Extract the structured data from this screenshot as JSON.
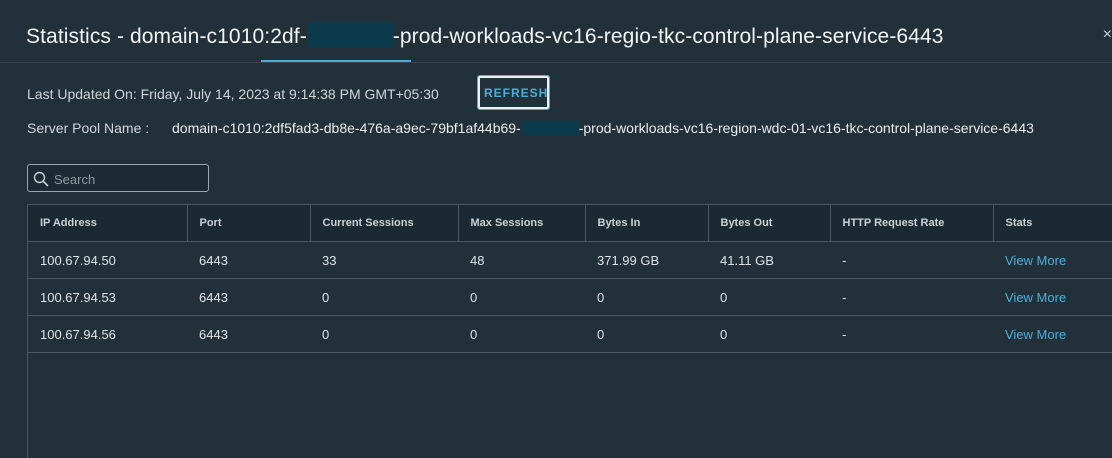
{
  "dialog": {
    "title_prefix": "Statistics - domain-c1010:2df-",
    "title_suffix": "-prod-workloads-vc16-regio-tkc-control-plane-service-6443",
    "close_glyph": "×"
  },
  "info": {
    "last_updated": "Last Updated On: Friday, July 14, 2023 at 9:14:38 PM GMT+05:30",
    "refresh_label": "REFRESH",
    "pool_label": "Server Pool Name :",
    "pool_value_prefix": "domain-c1010:2df5fad3-db8e-476a-a9ec-79bf1af44b69-",
    "pool_value_suffix": "-prod-workloads-vc16-region-wdc-01-vc16-tkc-control-plane-service-6443"
  },
  "search": {
    "placeholder": "Search"
  },
  "table": {
    "headers": [
      "IP Address",
      "Port",
      "Current Sessions",
      "Max Sessions",
      "Bytes In",
      "Bytes Out",
      "HTTP Request Rate",
      "Stats"
    ],
    "rows": [
      [
        "100.67.94.50",
        "6443",
        "33",
        "48",
        "371.99 GB",
        "41.11 GB",
        "-",
        "View More"
      ],
      [
        "100.67.94.53",
        "6443",
        "0",
        "0",
        "0",
        "0",
        "-",
        "View More"
      ],
      [
        "100.67.94.56",
        "6443",
        "0",
        "0",
        "0",
        "0",
        "-",
        "View More"
      ]
    ]
  },
  "colors": {
    "background": "#22303a",
    "accent": "#49afd9",
    "redaction": "#0b3a4d"
  }
}
